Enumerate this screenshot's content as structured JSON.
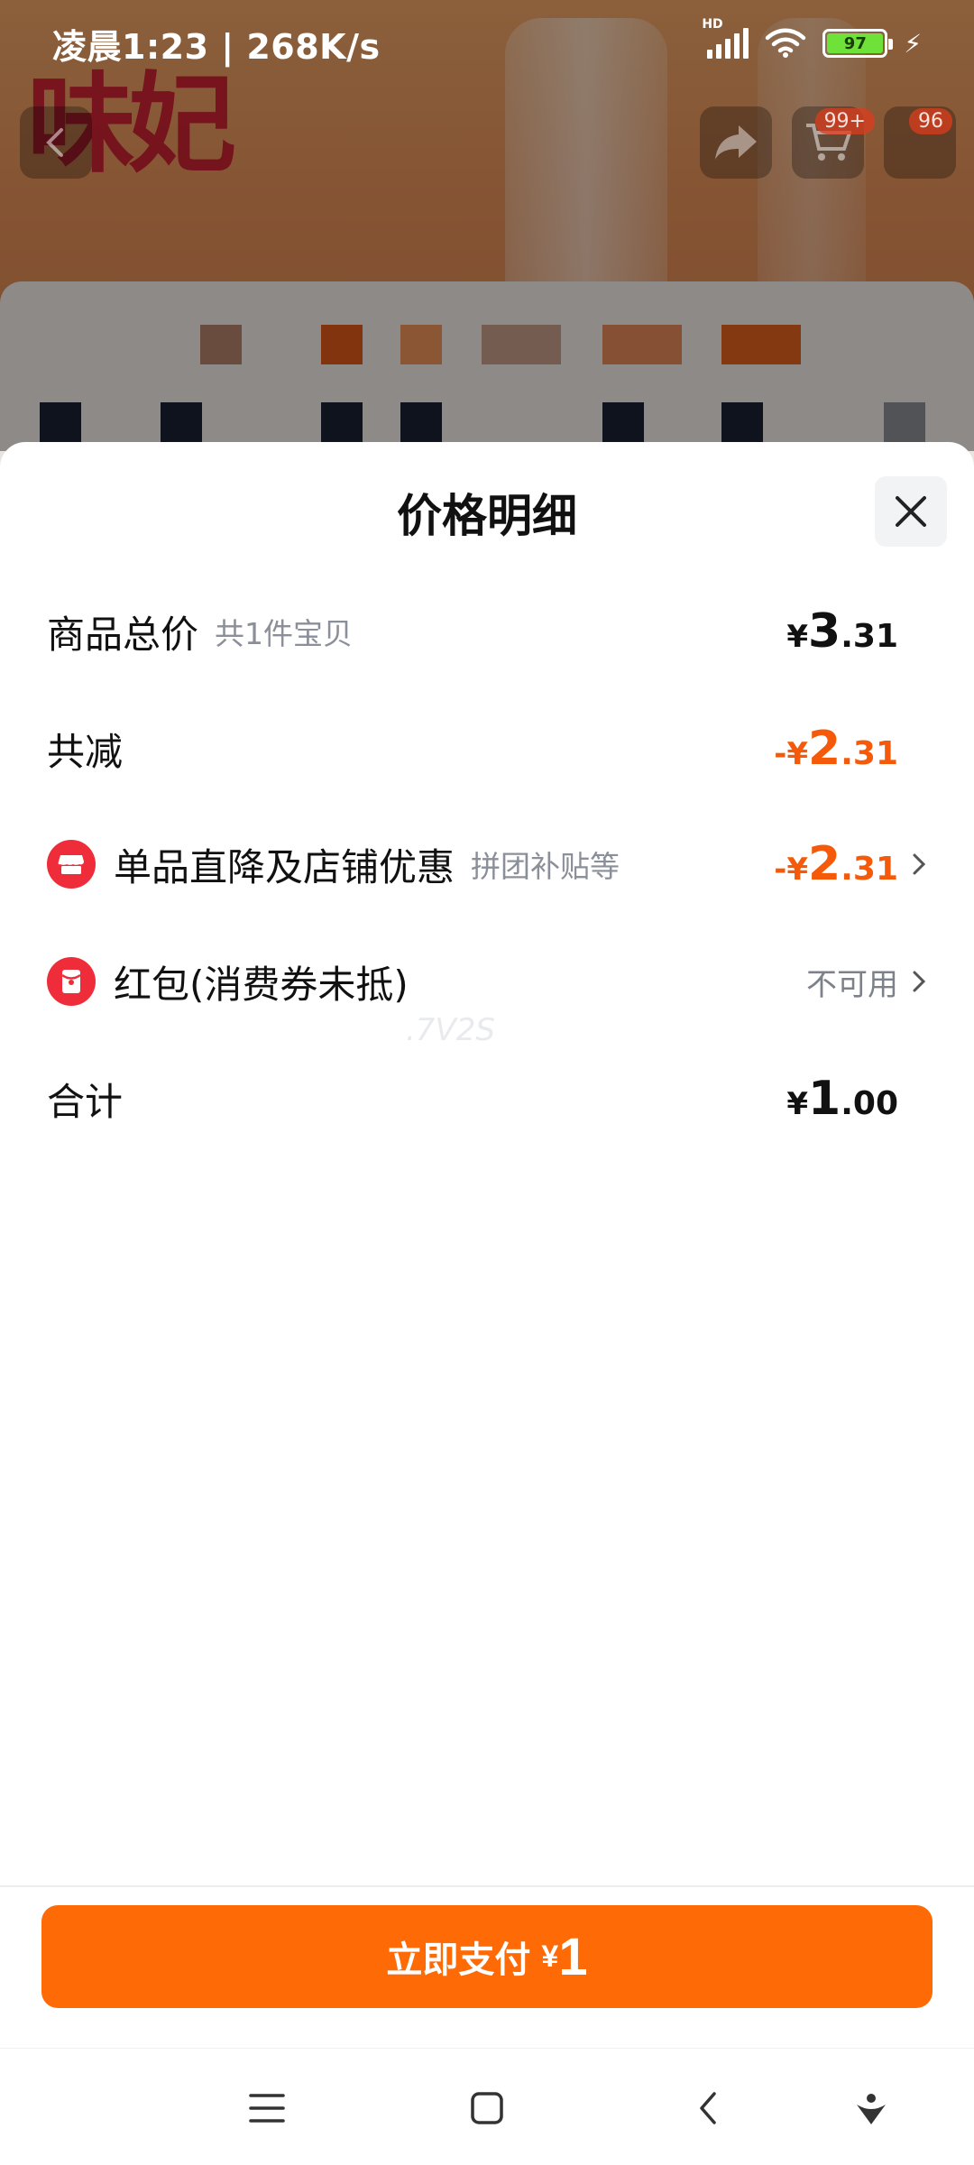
{
  "status_bar": {
    "time_speed": "凌晨1:23 | 268K/s",
    "network_badge": "HD",
    "battery": "97",
    "icons": [
      "signal-icon",
      "wifi-icon",
      "battery-icon",
      "charging-icon"
    ]
  },
  "background": {
    "cart_badge": "99+",
    "msg_badge": "96"
  },
  "sheet": {
    "title": "价格明细",
    "rows": [
      {
        "label": "商品总价",
        "sub": "共1件宝贝",
        "price": {
          "currency": "¥",
          "int": "3",
          "dec": ".31"
        }
      },
      {
        "label": "共减",
        "price": {
          "currency": "-¥",
          "int": "2",
          "dec": ".31"
        }
      },
      {
        "label": "单品直降及店铺优惠",
        "sub": "拼团补贴等",
        "icon": "shop-icon",
        "price": {
          "currency": "-¥",
          "int": "2",
          "dec": ".31"
        }
      },
      {
        "label": "红包(消费券未抵)",
        "icon": "red-envelope-icon",
        "value": "不可用"
      },
      {
        "label": "合计",
        "price": {
          "currency": "¥",
          "int": "1",
          "dec": ".00"
        }
      }
    ],
    "watermark": ".7V2S"
  },
  "footer": {
    "pay_label": "立即支付",
    "pay_currency": "¥",
    "pay_amount": "1"
  },
  "colors": {
    "accent_orange": "#f45a09",
    "pay_button": "#fe6a06",
    "icon_red": "#ef2d3a"
  }
}
